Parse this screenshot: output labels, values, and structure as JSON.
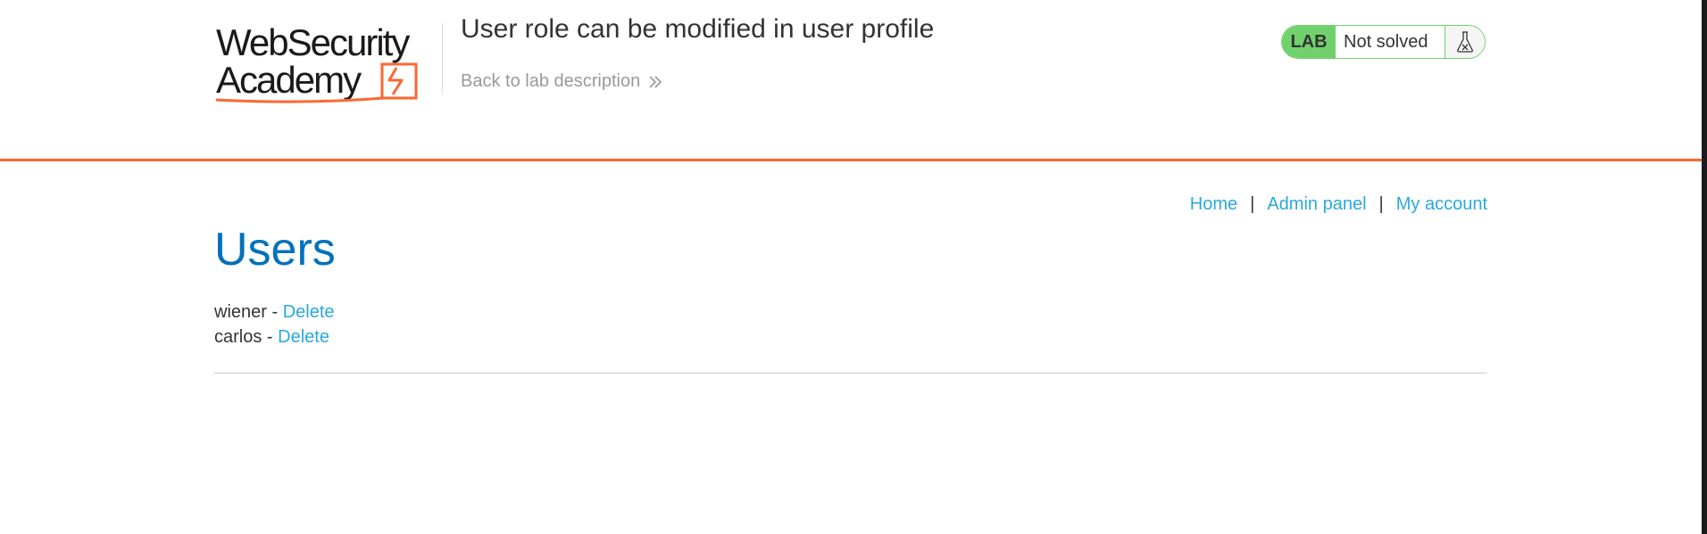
{
  "header": {
    "logo_line1": "WebSecurity",
    "logo_line2": "Academy",
    "lab_title": "User role can be modified in user profile",
    "back_link": "Back to lab description",
    "badge": {
      "label": "LAB",
      "status": "Not solved"
    }
  },
  "nav": {
    "home": "Home",
    "separator": "|",
    "admin_panel": "Admin panel",
    "my_account": "My account"
  },
  "main": {
    "heading": "Users",
    "users": [
      {
        "name": "wiener",
        "separator": " - ",
        "action": "Delete"
      },
      {
        "name": "carlos",
        "separator": " - ",
        "action": "Delete"
      }
    ]
  },
  "colors": {
    "accent": "#ff6633",
    "link": "#29a9dc",
    "heading": "#0071bc",
    "badge_green": "#70d16d"
  },
  "icons": {
    "back": "double-chevron-right-icon",
    "flask": "flask-icon"
  }
}
